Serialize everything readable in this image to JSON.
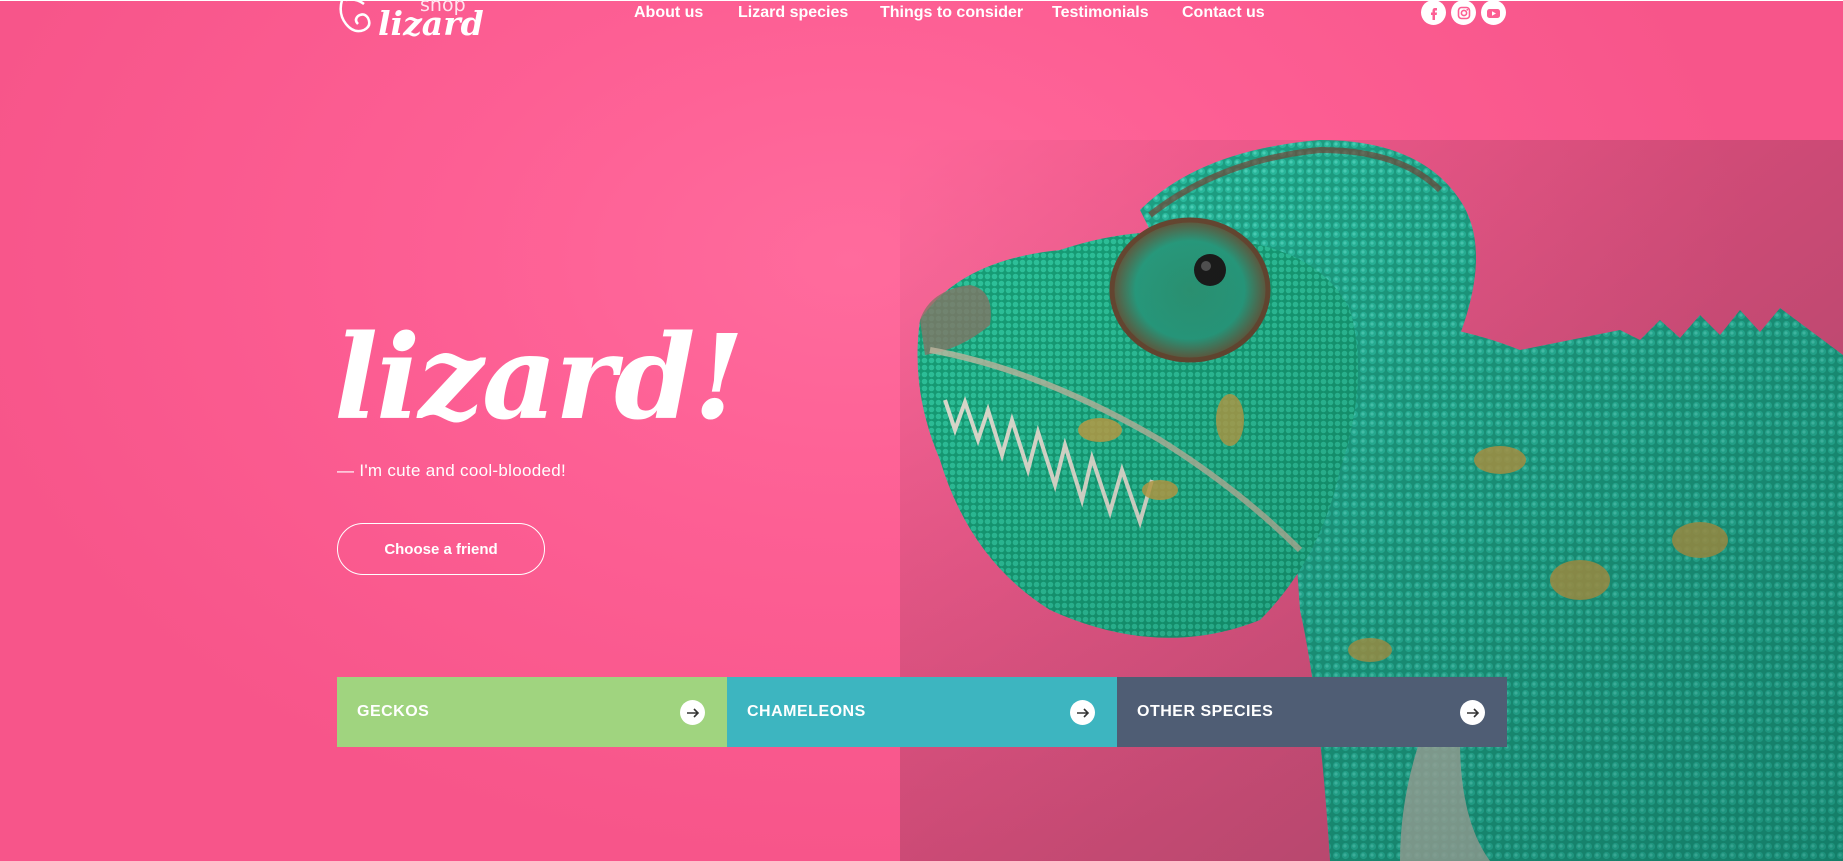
{
  "colors": {
    "hero_bg": "#fd5f94",
    "geckos_tile": "#a0d47f",
    "chameleons_tile": "#3db5c0",
    "other_tile": "#4f5d74",
    "text": "#ffffff"
  },
  "logo": {
    "small": "shop",
    "main": "lizard"
  },
  "nav": {
    "items": [
      {
        "label": "About us"
      },
      {
        "label": "Lizard species"
      },
      {
        "label": "Things to consider"
      },
      {
        "label": "Testimonials"
      },
      {
        "label": "Contact us"
      }
    ]
  },
  "social": [
    {
      "icon": "facebook-icon",
      "glyph": "f"
    },
    {
      "icon": "instagram-icon",
      "glyph": ""
    },
    {
      "icon": "youtube-icon",
      "glyph": ""
    }
  ],
  "hero": {
    "title": "lizard!",
    "subtitle": "— I'm cute and cool-blooded!",
    "cta_label": "Choose a friend"
  },
  "categories": [
    {
      "label": "GECKOS",
      "icon": "arrow-right-icon"
    },
    {
      "label": "CHAMELEONS",
      "icon": "arrow-right-icon"
    },
    {
      "label": "OTHER SPECIES",
      "icon": "arrow-right-icon"
    }
  ]
}
